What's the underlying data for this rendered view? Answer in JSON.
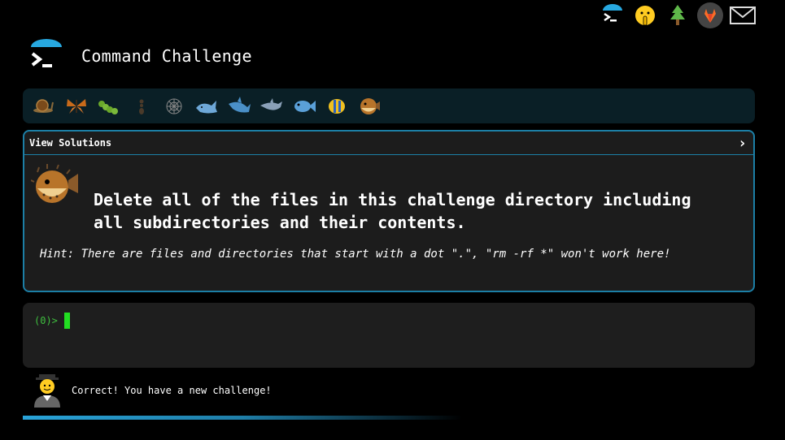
{
  "topbar": {
    "icons": [
      "terminal-umbrella-icon",
      "shushing-face-icon",
      "tree-icon",
      "gitlab-icon",
      "mail-icon"
    ]
  },
  "header": {
    "title": "Command Challenge"
  },
  "animals": [
    "snail-icon",
    "butterfly-icon",
    "caterpillar-icon",
    "ant-icon",
    "spider-web-icon",
    "whale-icon",
    "shark-icon",
    "dolphin-icon",
    "fish-icon",
    "tropical-fish-icon",
    "blowfish-icon"
  ],
  "panel": {
    "view_solutions": "View Solutions",
    "task_line1": "Delete all of the files in this challenge directory including",
    "task_line2": "all subdirectories and their contents.",
    "hint": "Hint: There are files and directories that start with a dot \".\", \"rm -rf *\" won't work here!"
  },
  "terminal": {
    "prompt": "(0)>"
  },
  "feedback": {
    "message": "Correct! You have a new challenge!"
  },
  "progress": {
    "fraction": 0.6
  },
  "colors": {
    "accent": "#1c7fa6",
    "prompt_green": "#3fbf3f",
    "cursor_green": "#22dd22",
    "panel_bg": "#1c1c1c",
    "bar_bg": "#0a1f26"
  }
}
